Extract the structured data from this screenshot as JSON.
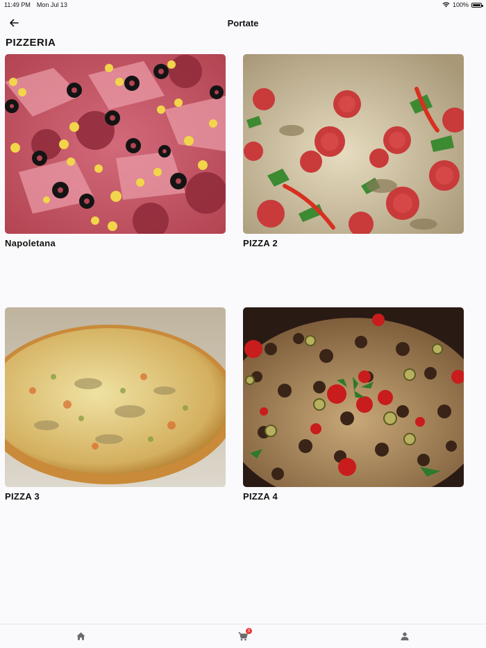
{
  "status_bar": {
    "time": "11:49 PM",
    "date": "Mon Jul 13",
    "battery_percent": "100%",
    "battery_level": 1.0,
    "wifi_icon": "wifi-icon",
    "battery_icon": "battery-icon"
  },
  "nav": {
    "title": "Portate",
    "back_icon": "arrow-left-icon"
  },
  "section": {
    "title": "PIZZERIA"
  },
  "products": [
    {
      "name": "Napoletana"
    },
    {
      "name": "PIZZA 2"
    },
    {
      "name": "PIZZA 3"
    },
    {
      "name": "PIZZA 4"
    }
  ],
  "tab_bar": {
    "tabs": [
      {
        "icon": "home-icon"
      },
      {
        "icon": "cart-icon",
        "badge": "0"
      },
      {
        "icon": "person-icon"
      }
    ]
  },
  "colors": {
    "background": "#fafafc",
    "badge": "#e53935",
    "tab_icon": "#6b6b6b"
  }
}
